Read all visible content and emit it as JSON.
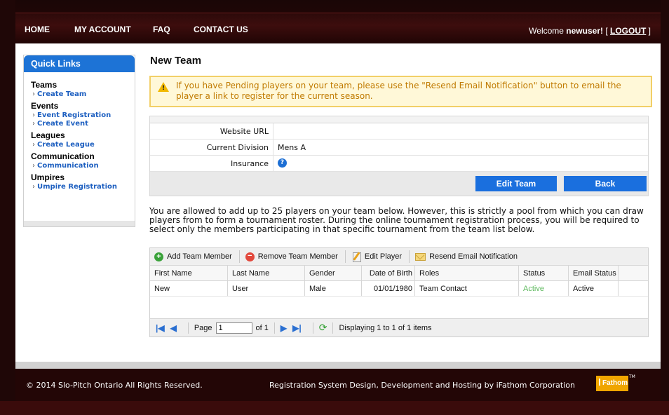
{
  "nav": {
    "home": "HOME",
    "my_account": "MY ACCOUNT",
    "faq": "FAQ",
    "contact": "CONTACT US",
    "welcome_prefix": "Welcome ",
    "username": "newuser!",
    "logout_open": " [ ",
    "logout": "LOGOUT",
    "logout_close": " ]"
  },
  "sidebar": {
    "title": "Quick Links",
    "groups": [
      {
        "label": "Teams",
        "links": [
          "Create Team"
        ]
      },
      {
        "label": "Events",
        "links": [
          "Event Registration",
          "Create Event"
        ]
      },
      {
        "label": "Leagues",
        "links": [
          "Create League"
        ]
      },
      {
        "label": "Communication",
        "links": [
          "Communication"
        ]
      },
      {
        "label": "Umpires",
        "links": [
          "Umpire Registration"
        ]
      }
    ]
  },
  "page": {
    "title": "New Team",
    "notice": "If you have Pending players on your team, please use the \"Resend Email Notification\" button to email the player a link to register for the current season.",
    "fields": [
      {
        "label": "Website URL",
        "value": ""
      },
      {
        "label": "Current Division",
        "value": "Mens A"
      },
      {
        "label": "Insurance",
        "value": ""
      }
    ],
    "edit_button": "Edit Team",
    "back_button": "Back",
    "info_text": "You are allowed to add up to 25 players on your team below. However, this is strictly a pool from which you can draw players from to form a tournament roster. During the online tournament registration process, you will be required to select only the members participating in that specific tournament from the team list below."
  },
  "grid": {
    "toolbar": {
      "add": "Add Team Member",
      "remove": "Remove Team Member",
      "edit": "Edit Player",
      "resend": "Resend Email Notification"
    },
    "columns": [
      "First Name",
      "Last Name",
      "Gender",
      "Date of Birth",
      "Roles",
      "Status",
      "Email Status"
    ],
    "rows": [
      [
        "New",
        "User",
        "Male",
        "01/01/1980",
        "Team Contact",
        "Active",
        "Active"
      ]
    ],
    "pager": {
      "page_label": "Page",
      "page_value": "1",
      "of_label": "of 1",
      "displaying": "Displaying 1 to 1 of 1 items"
    }
  },
  "footer": {
    "copyright": "© 2014 Slo-Pitch Ontario All Rights Reserved.",
    "credit": "Registration System Design, Development and Hosting by iFathom Corporation",
    "logo": "Fathom",
    "logo_tm": "TM"
  },
  "colors": {
    "accent": "#1d73d6",
    "frame": "#230606",
    "notice_border": "#f2cf67",
    "status_active": "#5cb85c"
  },
  "icons": [
    "warning-icon",
    "help-icon",
    "add-icon",
    "remove-icon",
    "edit-icon",
    "mail-icon",
    "first-page-icon",
    "prev-page-icon",
    "next-page-icon",
    "last-page-icon",
    "refresh-icon"
  ]
}
